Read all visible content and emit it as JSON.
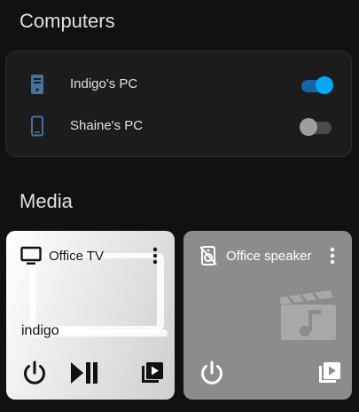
{
  "sections": {
    "computers_title": "Computers",
    "media_title": "Media"
  },
  "computers": [
    {
      "label": "Indigo's PC",
      "icon": "desktop-tower-icon",
      "state": "on"
    },
    {
      "label": "Shaine's PC",
      "icon": "mobile-device-icon",
      "state": "off"
    }
  ],
  "media": [
    {
      "name": "Office TV",
      "icon": "television-icon",
      "source": "indigo",
      "controls": [
        "power-icon",
        "play-pause-icon",
        "media-browse-icon"
      ]
    },
    {
      "name": "Office speaker",
      "icon": "speaker-off-icon",
      "source": "",
      "controls": [
        "power-icon",
        "media-browse-icon"
      ]
    }
  ],
  "colors": {
    "background": "#111111",
    "card": "#1c1c1c",
    "accent": "#03a9f4",
    "icon_blue": "#44739e",
    "speaker_card": "#8c8c8c"
  }
}
